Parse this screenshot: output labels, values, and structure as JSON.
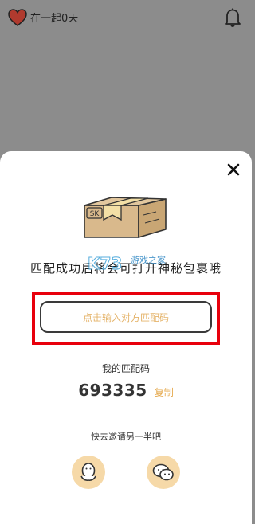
{
  "header": {
    "together_text": "在一起0天"
  },
  "modal": {
    "headline": "匹配成功后将会可打开神秘包裹哦",
    "box_label": "SK",
    "watermark": "游戏之家",
    "code_input": {
      "placeholder": "点击输入对方匹配码"
    },
    "my_code_label": "我的匹配码",
    "my_code": "693335",
    "copy_label": "复制",
    "invite_text": "快去邀请另一半吧",
    "share": [
      "qq",
      "wechat"
    ]
  },
  "colors": {
    "accent": "#e5b46b",
    "copy": "#e5a94d",
    "heart": "#b03a2e",
    "highlight": "#e8000c",
    "overlay": "#8c8c8c",
    "share_bg": "#f6d9a8"
  }
}
